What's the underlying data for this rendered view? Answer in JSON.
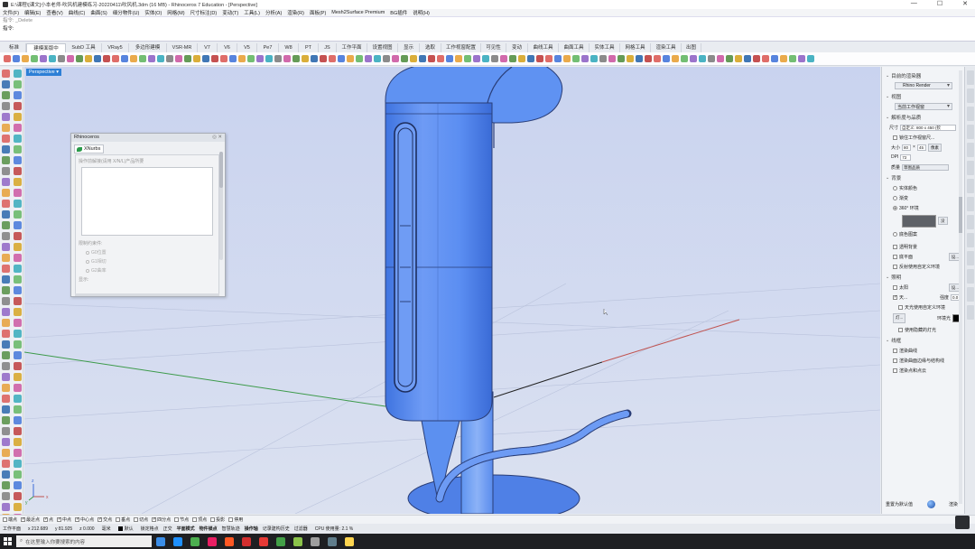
{
  "window": {
    "title": "E:\\课程\\[课文]小本老师-吹风机建模练习-20220411\\吹风机.3dm (16 MB) - Rhinoceros 7 Education - [Perspective]",
    "controls": [
      "—",
      "☐",
      "✕"
    ]
  },
  "menu": [
    "文件(F)",
    "编辑(E)",
    "查看(V)",
    "曲线(C)",
    "曲面(S)",
    "细分物件(U)",
    "实体(O)",
    "网格(M)",
    "尺寸标注(D)",
    "变动(T)",
    "工具(L)",
    "分析(A)",
    "渲染(R)",
    "面板(P)",
    "Mesh2Surface Premium",
    "BG插件",
    "说明(H)"
  ],
  "command": {
    "history": "指令: _Delete",
    "prompt": "指令:"
  },
  "tabs": [
    {
      "label": "标准",
      "w": 26
    },
    {
      "label": "建模面版中",
      "w": 44,
      "active": true
    },
    {
      "label": "SubD 工具",
      "w": 40
    },
    {
      "label": "VRay5",
      "w": 30
    },
    {
      "label": "多边形建模",
      "w": 42
    },
    {
      "label": "VSR-MR",
      "w": 34
    },
    {
      "label": "V7",
      "w": 22
    },
    {
      "label": "V6",
      "w": 22
    },
    {
      "label": "V5",
      "w": 22
    },
    {
      "label": "Pe7",
      "w": 24
    },
    {
      "label": "W8",
      "w": 22
    },
    {
      "label": "PT",
      "w": 22
    },
    {
      "label": "JS",
      "w": 20
    },
    {
      "label": "工作平面",
      "w": 34
    },
    {
      "label": "设置视图",
      "w": 34
    },
    {
      "label": "显示",
      "w": 24
    },
    {
      "label": "选取",
      "w": 24
    },
    {
      "label": "工作视窗配置",
      "w": 44
    },
    {
      "label": "可见性",
      "w": 28
    },
    {
      "label": "变动",
      "w": 24
    },
    {
      "label": "曲线工具",
      "w": 34
    },
    {
      "label": "曲面工具",
      "w": 34
    },
    {
      "label": "实体工具",
      "w": 34
    },
    {
      "label": "网格工具",
      "w": 34
    },
    {
      "label": "渲染工具",
      "w": 34
    },
    {
      "label": "出图",
      "w": 22
    }
  ],
  "viewport": {
    "label": "Perspective ▾"
  },
  "float_panel": {
    "title": "Rhinoceros",
    "title_buttons": "◎ ✕",
    "tab": "XNurbs",
    "hint": "操作前解接(请用 X/N/L)产品所要",
    "section": "限制约束件:",
    "options": [
      "G0位置",
      "G1相切",
      "G2曲率"
    ],
    "footer": "显示:"
  },
  "right_panel": {
    "renderer_section": "目前的渲染器",
    "renderer": "Rhino Render",
    "view_section": "视图",
    "view_value": "当前工作视窗",
    "resolution_section": "解析度与品质",
    "size_label": "尺寸",
    "size_value": "自定义: 800 x 450 (钦",
    "lock_label": "锁住工作视窗尺...",
    "dim_label": "大小",
    "dim_w": "80",
    "dim_h": "45",
    "dim_unit": "像素",
    "dpi_label": "DPI",
    "dpi_value": "72",
    "quality_label": "质量",
    "quality_value": "草图品质",
    "background_section": "背景",
    "bg_options": [
      "实体颜色",
      "渐变",
      "360° 环境"
    ],
    "bg_env_btn": "没",
    "bg_extra": "底色图案",
    "transparent": "透明背景",
    "ground": "底平面",
    "ground_btn": "设...",
    "reflect": "反射使用自定义环境",
    "lighting_section": "照明",
    "sun": "太阳",
    "sun_btn": "设...",
    "sky": "天...",
    "sky_intensity_label": "强度",
    "sky_intensity": "0.0",
    "sky_custom": "天光使用自定义环境",
    "lights_btn": "灯...",
    "env_light": "环境光",
    "hidden_lights": "使用隐藏的灯光",
    "wire_section": "线框",
    "wire_options": [
      "渲染曲线",
      "渲染曲面边缘与结构线",
      "渲染点和点云"
    ],
    "reset": "重置为默认值",
    "render_btn": "渲染"
  },
  "osnap": {
    "items": [
      {
        "label": "端点",
        "on": false
      },
      {
        "label": "最近点",
        "on": true
      },
      {
        "label": "点",
        "on": true
      },
      {
        "label": "中点",
        "on": true
      },
      {
        "label": "中心点",
        "on": true
      },
      {
        "label": "交点",
        "on": true
      },
      {
        "label": "垂点",
        "on": false
      },
      {
        "label": "切点",
        "on": false
      },
      {
        "label": "四分点",
        "on": true
      },
      {
        "label": "节点",
        "on": false
      },
      {
        "label": "顶点",
        "on": false
      },
      {
        "label": "投影",
        "on": false
      },
      {
        "label": "停用",
        "on": false
      }
    ]
  },
  "status": {
    "cplane": "工作平面",
    "x": "x 212.689",
    "y": "y 81.925",
    "z": "z 0.000",
    "unit": "毫米",
    "layer": "默认",
    "items": [
      "锁定格点",
      "正交",
      "平面模式",
      "物件锁点",
      "智慧轨迹",
      "操作轴",
      "记录建构历史",
      "过滤器"
    ],
    "bold": [
      "平面模式",
      "物件锁点",
      "操作轴"
    ],
    "cpu": "CPU 使用量: 2.1 %"
  },
  "taskbar": {
    "search_placeholder": "在这里输入你要搜索的内容"
  },
  "colors": {
    "accent": "#2d7fd6",
    "model_blue": "#5b8ef2",
    "viewport_top": "#cfd7ee",
    "viewport_bottom": "#d9dff0"
  }
}
